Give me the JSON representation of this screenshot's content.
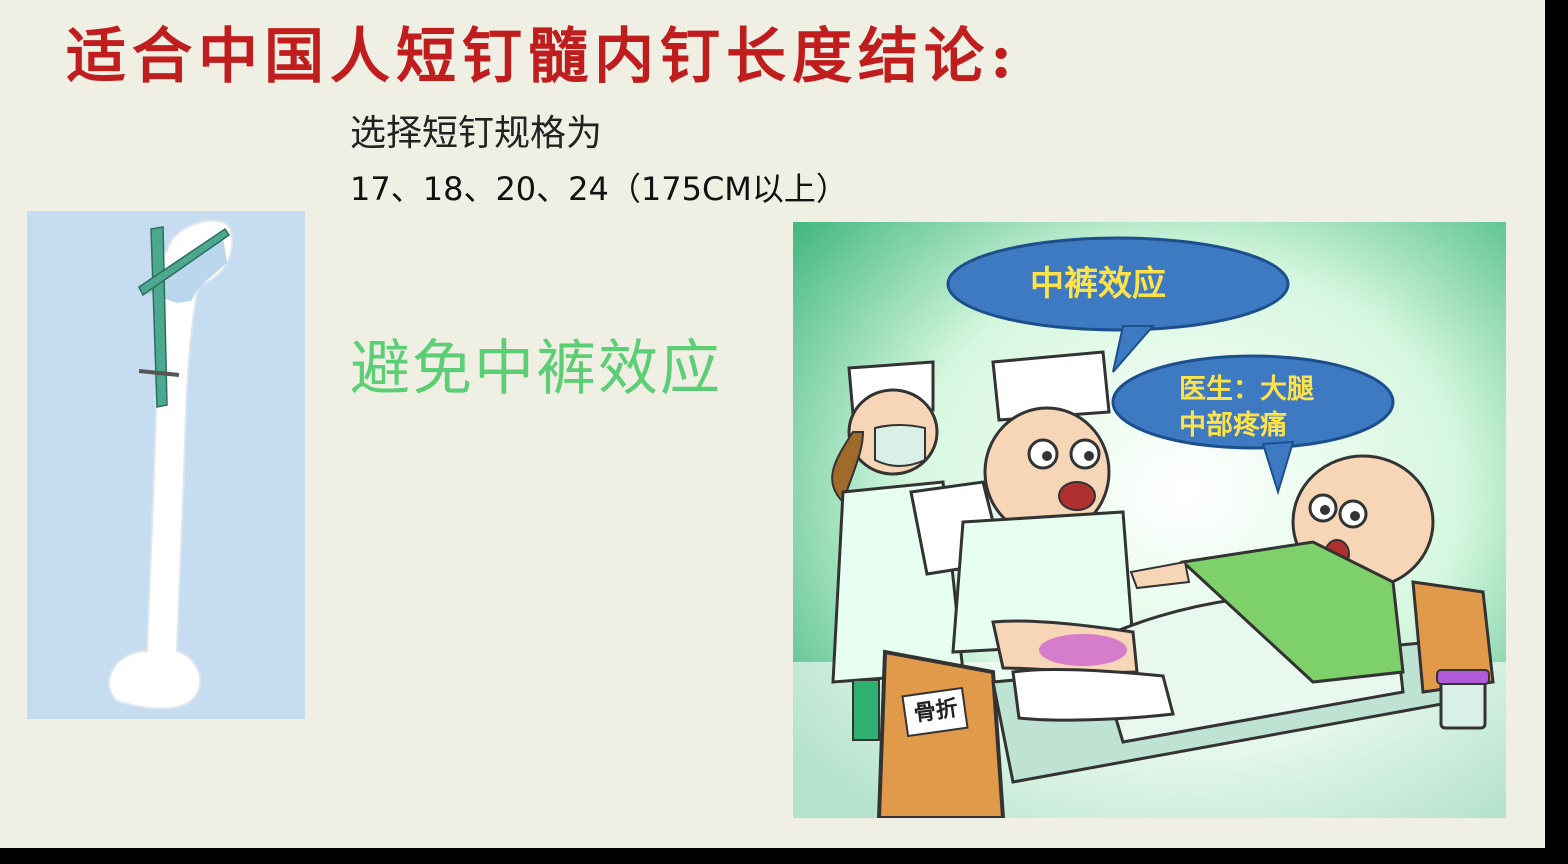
{
  "slide": {
    "title": "适合中国人短钉髓内钉长度结论:",
    "spec_label": "选择短钉规格为",
    "spec_values": "17、18、20、24（175CM以上）",
    "highlight": "避免中裤效应"
  },
  "cartoon": {
    "bubble_doctor": "中裤效应",
    "bubble_patient_line1": "医生：大腿",
    "bubble_patient_line2": "中部疼痛",
    "bed_sign": "骨折"
  },
  "colors": {
    "title": "#c01e1e",
    "highlight": "#5ccf76",
    "bubble_fill": "#3d7ac2",
    "bubble_text": "#ffe24a"
  },
  "icons": [
    "femur-nail-illustration",
    "doctor-patient-cartoon"
  ]
}
